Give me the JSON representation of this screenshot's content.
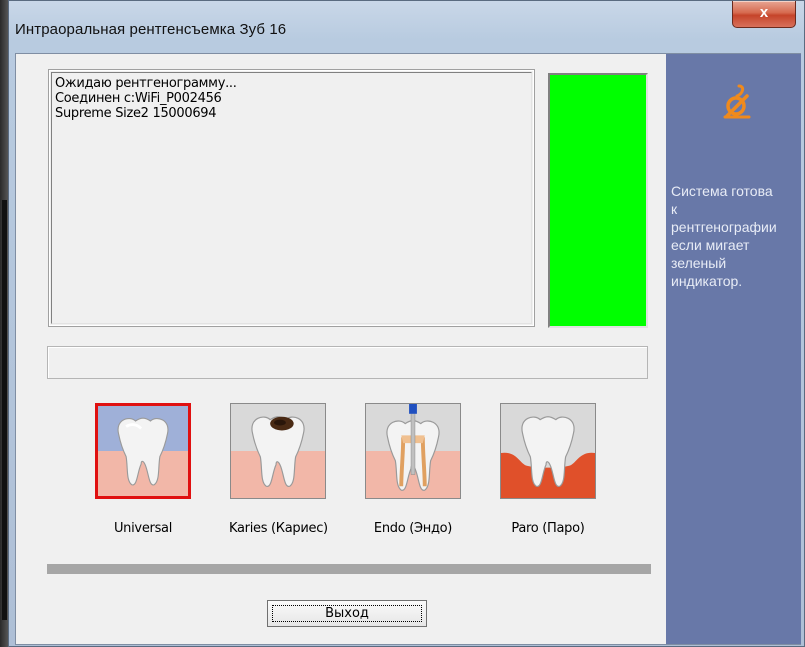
{
  "window": {
    "title": "Интраоральная  рентгенсъемка Зуб 16",
    "close_label": "x"
  },
  "log": {
    "lines": [
      "Ожидаю рентгенограмму...",
      "Соединен с:WiFi_P002456",
      "Supreme Size2 15000694"
    ]
  },
  "status_indicator": {
    "color": "#00ff00"
  },
  "modes": [
    {
      "label": "Universal",
      "selected": true
    },
    {
      "label": "Karies (Кариес)",
      "selected": false
    },
    {
      "label": "Endo (Эндо)",
      "selected": false
    },
    {
      "label": "Paro (Паро)",
      "selected": false
    }
  ],
  "exit_button": {
    "label": "Выход"
  },
  "side_panel": {
    "icon": "sensor-cable-icon",
    "accent": "#f08a1c",
    "message": "Система готова\nк\nрентгенографии\nесли мигает\nзеленый\nиндикатор."
  }
}
